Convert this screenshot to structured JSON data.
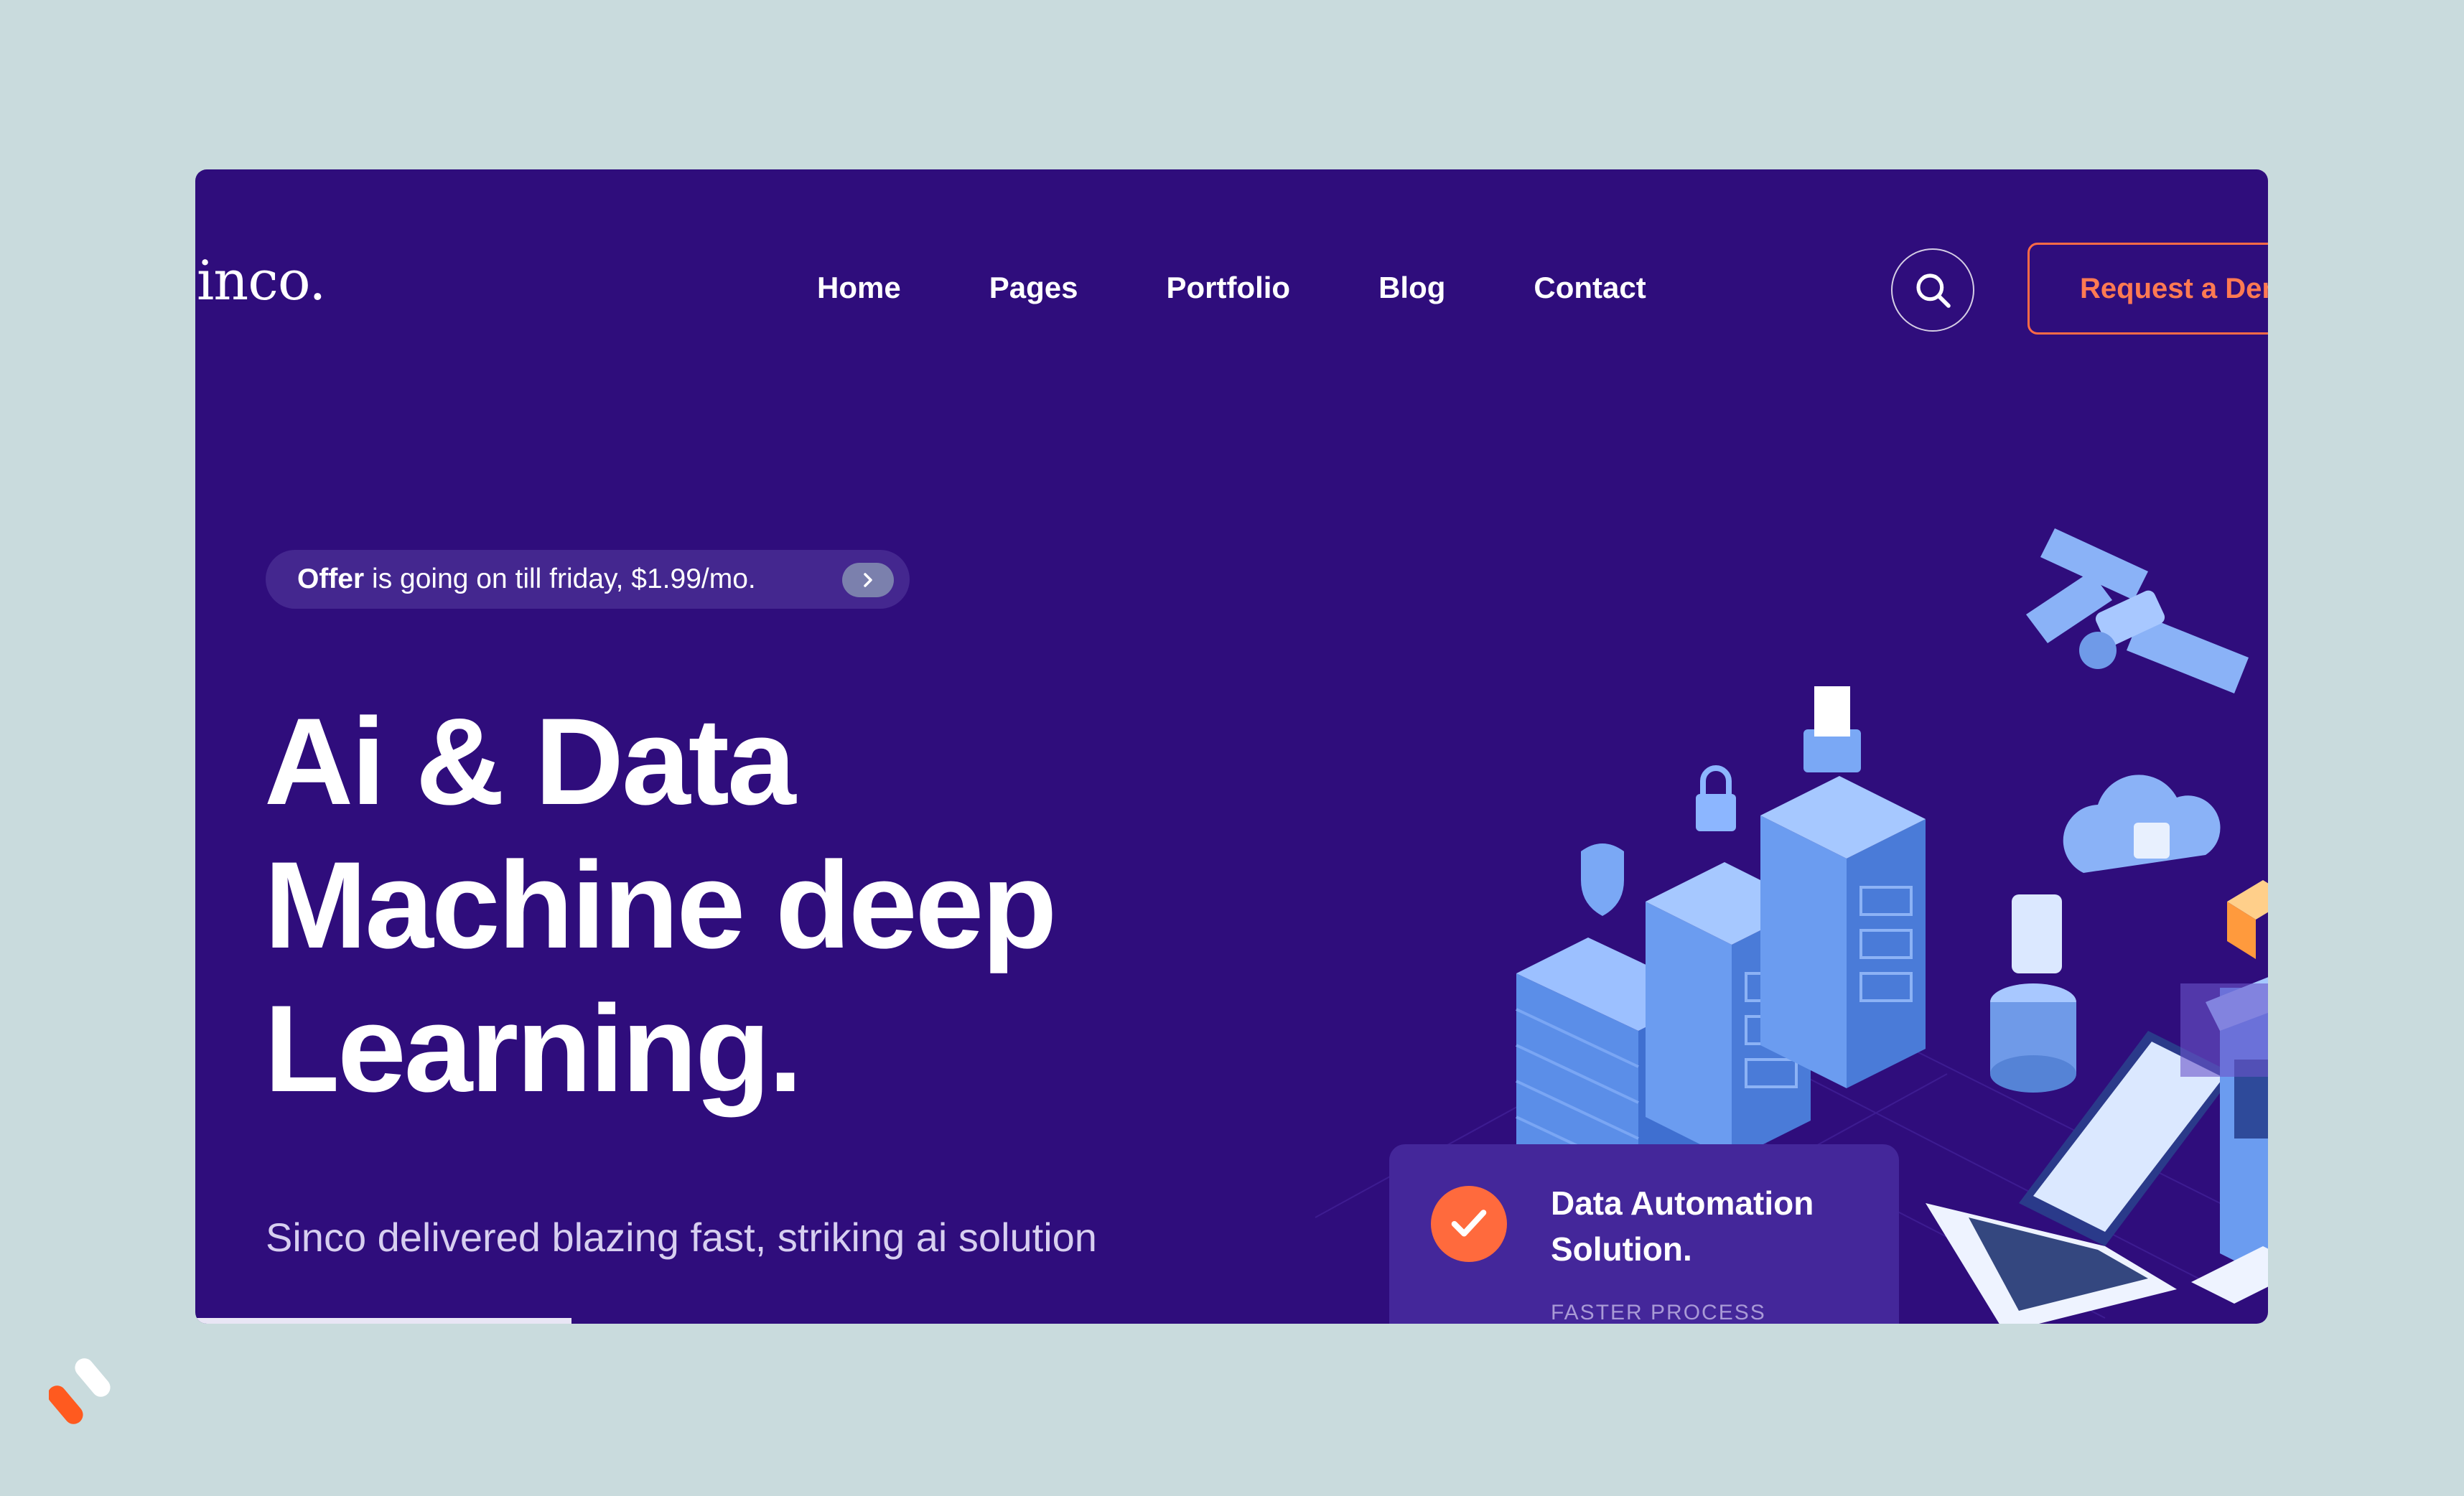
{
  "header": {
    "brand": "inco.",
    "nav": [
      "Home",
      "Pages",
      "Portfolio",
      "Blog",
      "Contact"
    ],
    "cta_label": "Request a Demo"
  },
  "offer": {
    "strong": "Offer",
    "text": " is going on till friday, $1.99/mo."
  },
  "hero": {
    "title_lines": [
      "Ai & Data",
      "Machine deep",
      "Learning."
    ],
    "subtitle": "Sinco delivered blazing fast, striking ai solution"
  },
  "card": {
    "title": "Data Automation Solution.",
    "subtitle": "FASTER PROCESS"
  },
  "colors": {
    "background": "#c9dbdd",
    "hero_bg": "#2f0d7c",
    "accent": "#ff6b45",
    "card_bg": "#44279a"
  },
  "icons": [
    "search-icon",
    "chevron-right-icon",
    "check-icon",
    "servers-illustration",
    "satellite-icon",
    "cloud-icon",
    "laptop-icon",
    "router-icon",
    "brand-mark-icon"
  ]
}
